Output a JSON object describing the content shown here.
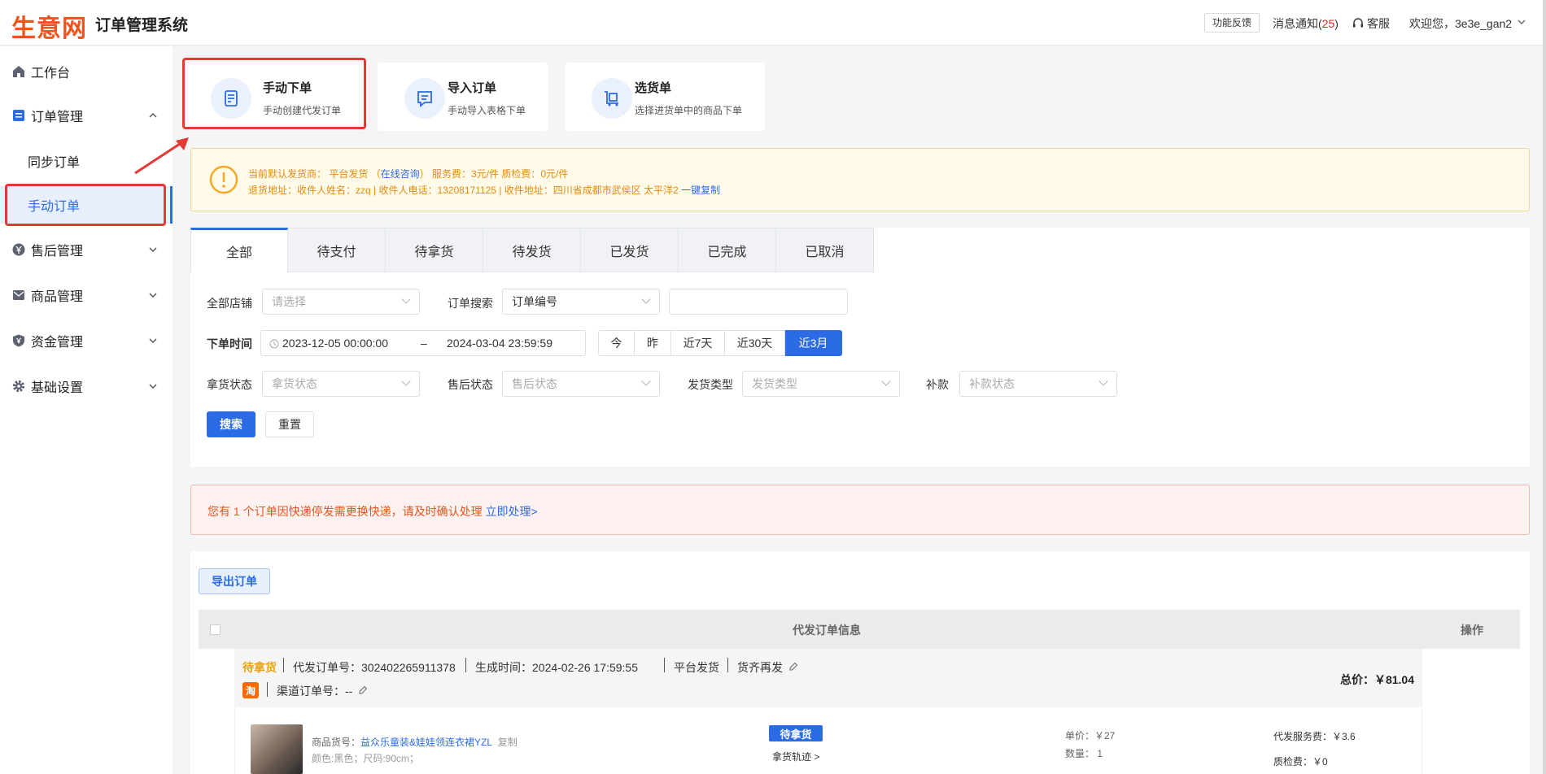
{
  "header": {
    "logo": "生意网",
    "title": "订单管理系统",
    "feedback": "功能反馈",
    "notice_label": "消息通知(",
    "notice_count": "25",
    "notice_close": ")",
    "service": "客服",
    "welcome": "欢迎您，3e3e_gan2"
  },
  "sidebar": {
    "workbench": "工作台",
    "orders": "订单管理",
    "sync_orders": "同步订单",
    "manual_orders": "手动订单",
    "aftersale": "售后管理",
    "goods": "商品管理",
    "funds": "资金管理",
    "settings": "基础设置"
  },
  "quick": [
    {
      "title": "手动下单",
      "sub": "手动创建代发订单"
    },
    {
      "title": "导入订单",
      "sub": "手动导入表格下单"
    },
    {
      "title": "选货单",
      "sub": "选择进货单中的商品下单"
    }
  ],
  "warn": {
    "line1_a": "当前默认发货商：  平台发货  （",
    "consult": "在线咨询",
    "line1_b": "）  服务费：3元/件  质检费：0元/件",
    "line2": "退货地址：收件人姓名：zzq | 收件人电话：13208171125 | 收件地址：四川省成都市武侯区 太平洋2",
    "copy": "一键复制"
  },
  "tabs": [
    "全部",
    "待支付",
    "待拿货",
    "待发货",
    "已发货",
    "已完成",
    "已取消"
  ],
  "filters": {
    "store_label": "全部店铺",
    "store_ph": "请选择",
    "search_label": "订单搜索",
    "search_type": "订单编号",
    "time_label": "下单时间",
    "time_start": "2023-12-05 00:00:00",
    "time_sep": "–",
    "time_end": "2024-03-04 23:59:59",
    "quick_ranges": [
      "今",
      "昨",
      "近7天",
      "近30天",
      "近3月"
    ],
    "pick_label": "拿货状态",
    "pick_ph": "拿货状态",
    "after_label": "售后状态",
    "after_ph": "售后状态",
    "ship_label": "发货类型",
    "ship_ph": "发货类型",
    "refund_label": "补款",
    "refund_ph": "补款状态",
    "search_btn": "搜索",
    "reset_btn": "重置"
  },
  "alert": {
    "text": "您有 1 个订单因快递停发需更换快递，请及时确认处理",
    "link": "立即处理>"
  },
  "orders": {
    "export": "导出订单",
    "col_info": "代发订单信息",
    "col_ops": "操作",
    "status": "待拿货",
    "order_no": "代发订单号：302402265911378",
    "created": "生成时间：2024-02-26 17:59:55",
    "platform": "平台发货",
    "restock": "货齐再发",
    "taobao": "淘",
    "channel_no": "渠道订单号：--",
    "total": "总价：￥81.04",
    "item": {
      "code_label": "商品货号：",
      "code": "益众乐童装&娃娃领连衣裙YZL",
      "copy": "复制",
      "spec": "颜色:黑色；尺码:90cm；",
      "badge": "待拿货",
      "track": "拿货轨迹 >",
      "price": "单价：￥27",
      "qty": "数量：  1",
      "fee": "代发服务费：￥3.6",
      "qc": "质检费：￥0"
    }
  }
}
